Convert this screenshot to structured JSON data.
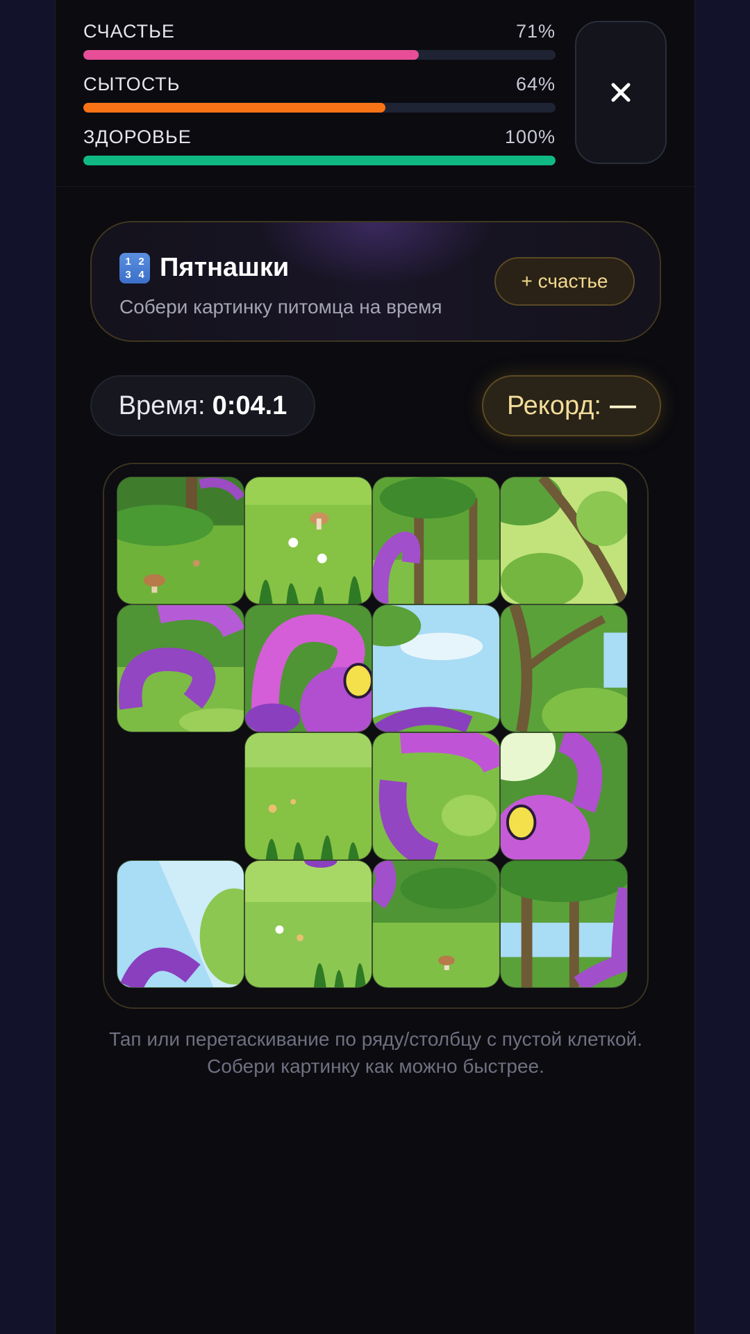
{
  "stats": [
    {
      "name": "СЧАСТЬЕ",
      "value": "71%",
      "level": 0.71,
      "color": "#e84e97"
    },
    {
      "name": "СЫТОСТЬ",
      "value": "64%",
      "level": 0.64,
      "color": "#f97316"
    },
    {
      "name": "ЗДОРОВЬЕ",
      "value": "100%",
      "level": 1.0,
      "color": "#10b981"
    }
  ],
  "close_icon": "close-icon",
  "game": {
    "icon": "keycap-1234-icon",
    "icon_digits": [
      "1",
      "2",
      "3",
      "4"
    ],
    "title": "Пятнашки",
    "subtitle": "Собери картинку питомца на время",
    "reward_label": "+ счастье"
  },
  "timer": {
    "label": "Время:",
    "value": "0:04.1"
  },
  "record": {
    "label": "Рекорд:",
    "value": "—"
  },
  "puzzle": {
    "grid": "4x4",
    "empty_cell": {
      "row": 3,
      "col": 1
    }
  },
  "hint": "Тап или перетаскивание по ряду/столбцу с пустой клеткой. Собери картинку как можно быстрее."
}
